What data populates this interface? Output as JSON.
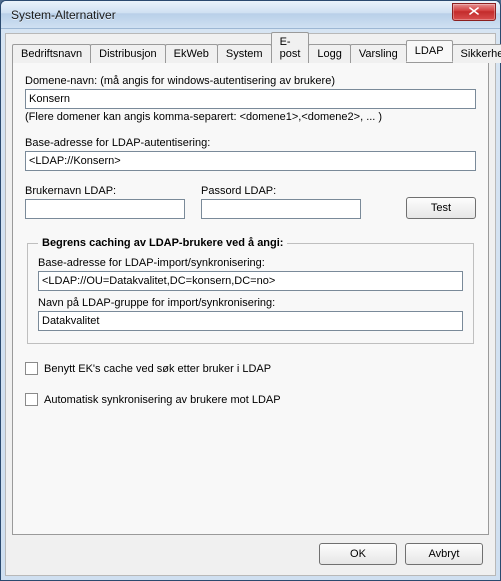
{
  "window": {
    "title": "System-Alternativer"
  },
  "tabs": {
    "items": [
      {
        "label": "Bedriftsnavn"
      },
      {
        "label": "Distribusjon"
      },
      {
        "label": "EkWeb"
      },
      {
        "label": "System"
      },
      {
        "label": "E-post"
      },
      {
        "label": "Logg"
      },
      {
        "label": "Varsling"
      },
      {
        "label": "LDAP"
      },
      {
        "label": "Sikkerhet"
      }
    ],
    "active_index": 7
  },
  "ldap": {
    "domain_label": "Domene-navn: (må angis for windows-autentisering av brukere)",
    "domain_value": "Konsern",
    "domain_note": "(Flere domener kan angis komma-separert: <domene1>,<domene2>, ... )",
    "base_auth_label": "Base-adresse for LDAP-autentisering:",
    "base_auth_value": "<LDAP://Konsern>",
    "user_label": "Brukernavn LDAP:",
    "user_value": "",
    "pass_label": "Passord LDAP:",
    "pass_value": "",
    "test_label": "Test",
    "group": {
      "legend": "Begrens caching av LDAP-brukere ved å angi:",
      "base_import_label": "Base-adresse for LDAP-import/synkronisering:",
      "base_import_value": "<LDAP://OU=Datakvalitet,DC=konsern,DC=no>",
      "group_name_label": "Navn på LDAP-gruppe for import/synkronisering:",
      "group_name_value": "Datakvalitet"
    },
    "chk_cache_label": "Benytt EK's cache ved søk etter bruker i LDAP",
    "chk_sync_label": "Automatisk synkronisering av brukere mot LDAP"
  },
  "footer": {
    "ok_label": "OK",
    "cancel_label": "Avbryt"
  }
}
